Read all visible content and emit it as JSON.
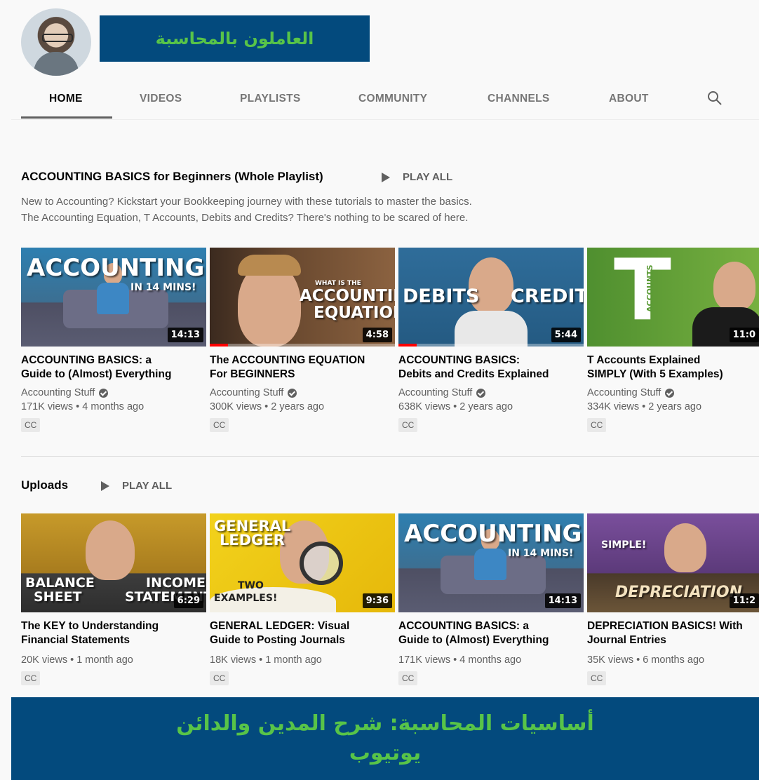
{
  "header": {
    "channel_title": "العاملون بالمحاسبة",
    "tabs": [
      "HOME",
      "VIDEOS",
      "PLAYLISTS",
      "COMMUNITY",
      "CHANNELS",
      "ABOUT"
    ],
    "active_tab": "HOME"
  },
  "playlist_shelf": {
    "title": "ACCOUNTING BASICS for Beginners (Whole Playlist)",
    "play_all": "PLAY ALL",
    "description_line1": "New to Accounting? Kickstart your Bookkeeping journey with these tutorials to master the basics.",
    "description_line2": "The Accounting Equation, T Accounts, Debits and Credits? There's nothing to be scared of here.",
    "videos": [
      {
        "title_line1": "ACCOUNTING BASICS: a",
        "title_line2": "Guide to (Almost) Everything",
        "channel": "Accounting Stuff",
        "meta": "171K views • 4 months ago",
        "duration": "14:13",
        "cc": "CC",
        "thumb_text1": "ACCOUNTING",
        "thumb_text2": "IN 14 MINS!",
        "progress": 0
      },
      {
        "title_line1": "The ACCOUNTING EQUATION",
        "title_line2": "For BEGINNERS",
        "channel": "Accounting Stuff",
        "meta": "300K views • 2 years ago",
        "duration": "4:58",
        "cc": "CC",
        "thumb_text1": "ACCOUNTING",
        "thumb_text2": "EQUATION?",
        "thumb_text3": "WHAT IS THE",
        "progress": 0.1
      },
      {
        "title_line1": "ACCOUNTING BASICS:",
        "title_line2": "Debits and Credits Explained",
        "channel": "Accounting Stuff",
        "meta": "638K views • 2 years ago",
        "duration": "5:44",
        "cc": "CC",
        "thumb_text1": "DEBITS",
        "thumb_text2": "CREDITS",
        "progress": 0.1
      },
      {
        "title_line1": "T Accounts Explained",
        "title_line2": "SIMPLY (With 5 Examples)",
        "channel": "Accounting Stuff",
        "meta": "334K views • 2 years ago",
        "duration": "11:0",
        "cc": "CC",
        "thumb_text1": "T",
        "thumb_text2": "ACCOUNTS",
        "progress": 0
      }
    ]
  },
  "uploads_shelf": {
    "title": "Uploads",
    "play_all": "PLAY ALL",
    "videos": [
      {
        "title_line1": "The KEY to Understanding",
        "title_line2": "Financial Statements",
        "meta": "20K views • 1 month ago",
        "duration": "6:29",
        "cc": "CC",
        "thumb_text1": "BALANCE",
        "thumb_text2": "SHEET",
        "thumb_text3": "INCOME",
        "thumb_text4": "STATEMENT"
      },
      {
        "title_line1": "GENERAL LEDGER: Visual",
        "title_line2": "Guide to Posting Journals",
        "meta": "18K views • 1 month ago",
        "duration": "9:36",
        "cc": "CC",
        "thumb_text1": "GENERAL",
        "thumb_text2": "LEDGER",
        "thumb_text3": "TWO",
        "thumb_text4": "EXAMPLES!"
      },
      {
        "title_line1": "ACCOUNTING BASICS: a",
        "title_line2": "Guide to (Almost) Everything",
        "meta": "171K views • 4 months ago",
        "duration": "14:13",
        "cc": "CC",
        "thumb_text1": "ACCOUNTING",
        "thumb_text2": "IN 14 MINS!"
      },
      {
        "title_line1": "DEPRECIATION BASICS! With",
        "title_line2": "Journal Entries",
        "meta": "35K views • 6 months ago",
        "duration": "11:2",
        "cc": "CC",
        "thumb_text1": "SIMPLE!",
        "thumb_text2": "DEPRECIATION"
      }
    ]
  },
  "banner": {
    "line1": "أساسيات المحاسبة: شرح المدين والدائن",
    "line2": "يوتيوب"
  },
  "colors": {
    "banner_bg": "#034a7d",
    "banner_text": "#58c448",
    "progress": "#ff0000"
  }
}
